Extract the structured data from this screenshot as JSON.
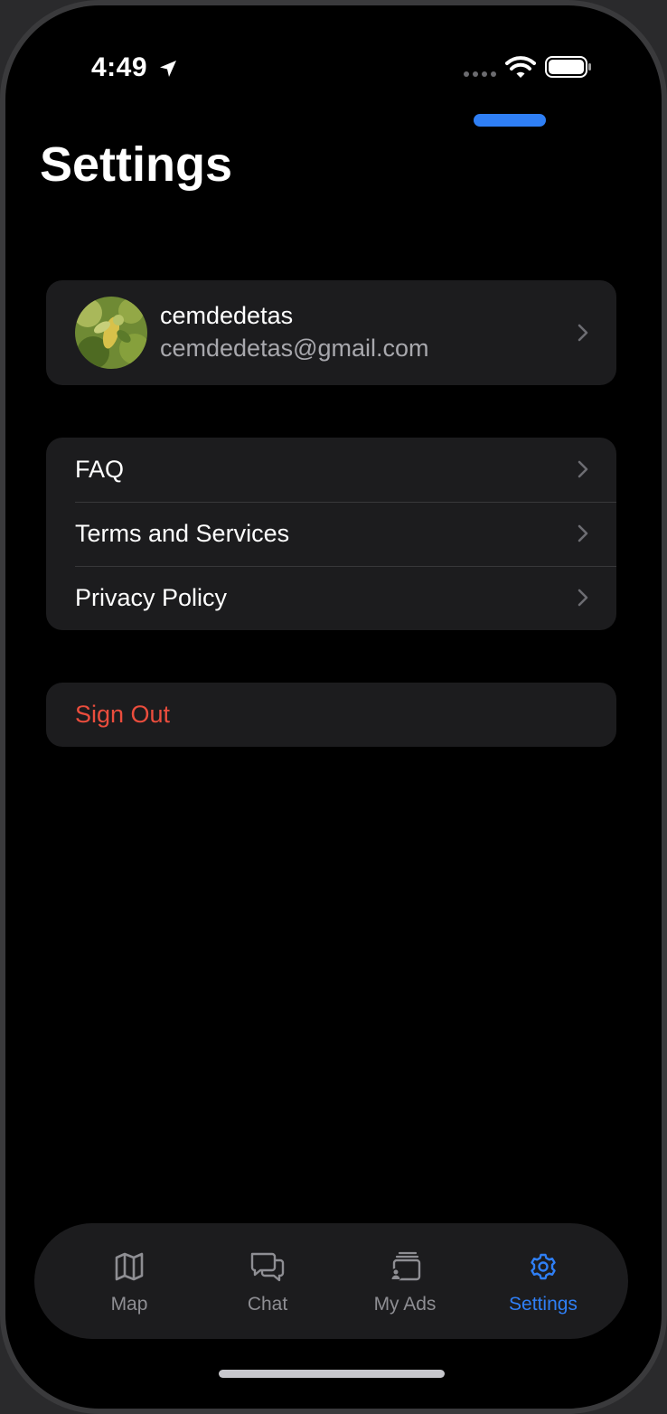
{
  "status_bar": {
    "time": "4:49",
    "icons": [
      "location-arrow-icon",
      "cellular-dots-icon",
      "wifi-icon",
      "battery-icon"
    ]
  },
  "header": {
    "title": "Settings"
  },
  "profile": {
    "name": "cemdedetas",
    "email": "cemdedetas@gmail.com"
  },
  "links": [
    {
      "label": "FAQ"
    },
    {
      "label": "Terms and Services"
    },
    {
      "label": "Privacy Policy"
    }
  ],
  "sign_out": {
    "label": "Sign Out",
    "color": "#eb4d3d"
  },
  "tab_bar": {
    "tabs": [
      {
        "label": "Map",
        "icon": "map-icon"
      },
      {
        "label": "Chat",
        "icon": "chat-bubbles-icon"
      },
      {
        "label": "My Ads",
        "icon": "ads-stack-icon"
      },
      {
        "label": "Settings",
        "icon": "gear-icon"
      }
    ],
    "active": "Settings",
    "accent": "#2f7ff5"
  }
}
